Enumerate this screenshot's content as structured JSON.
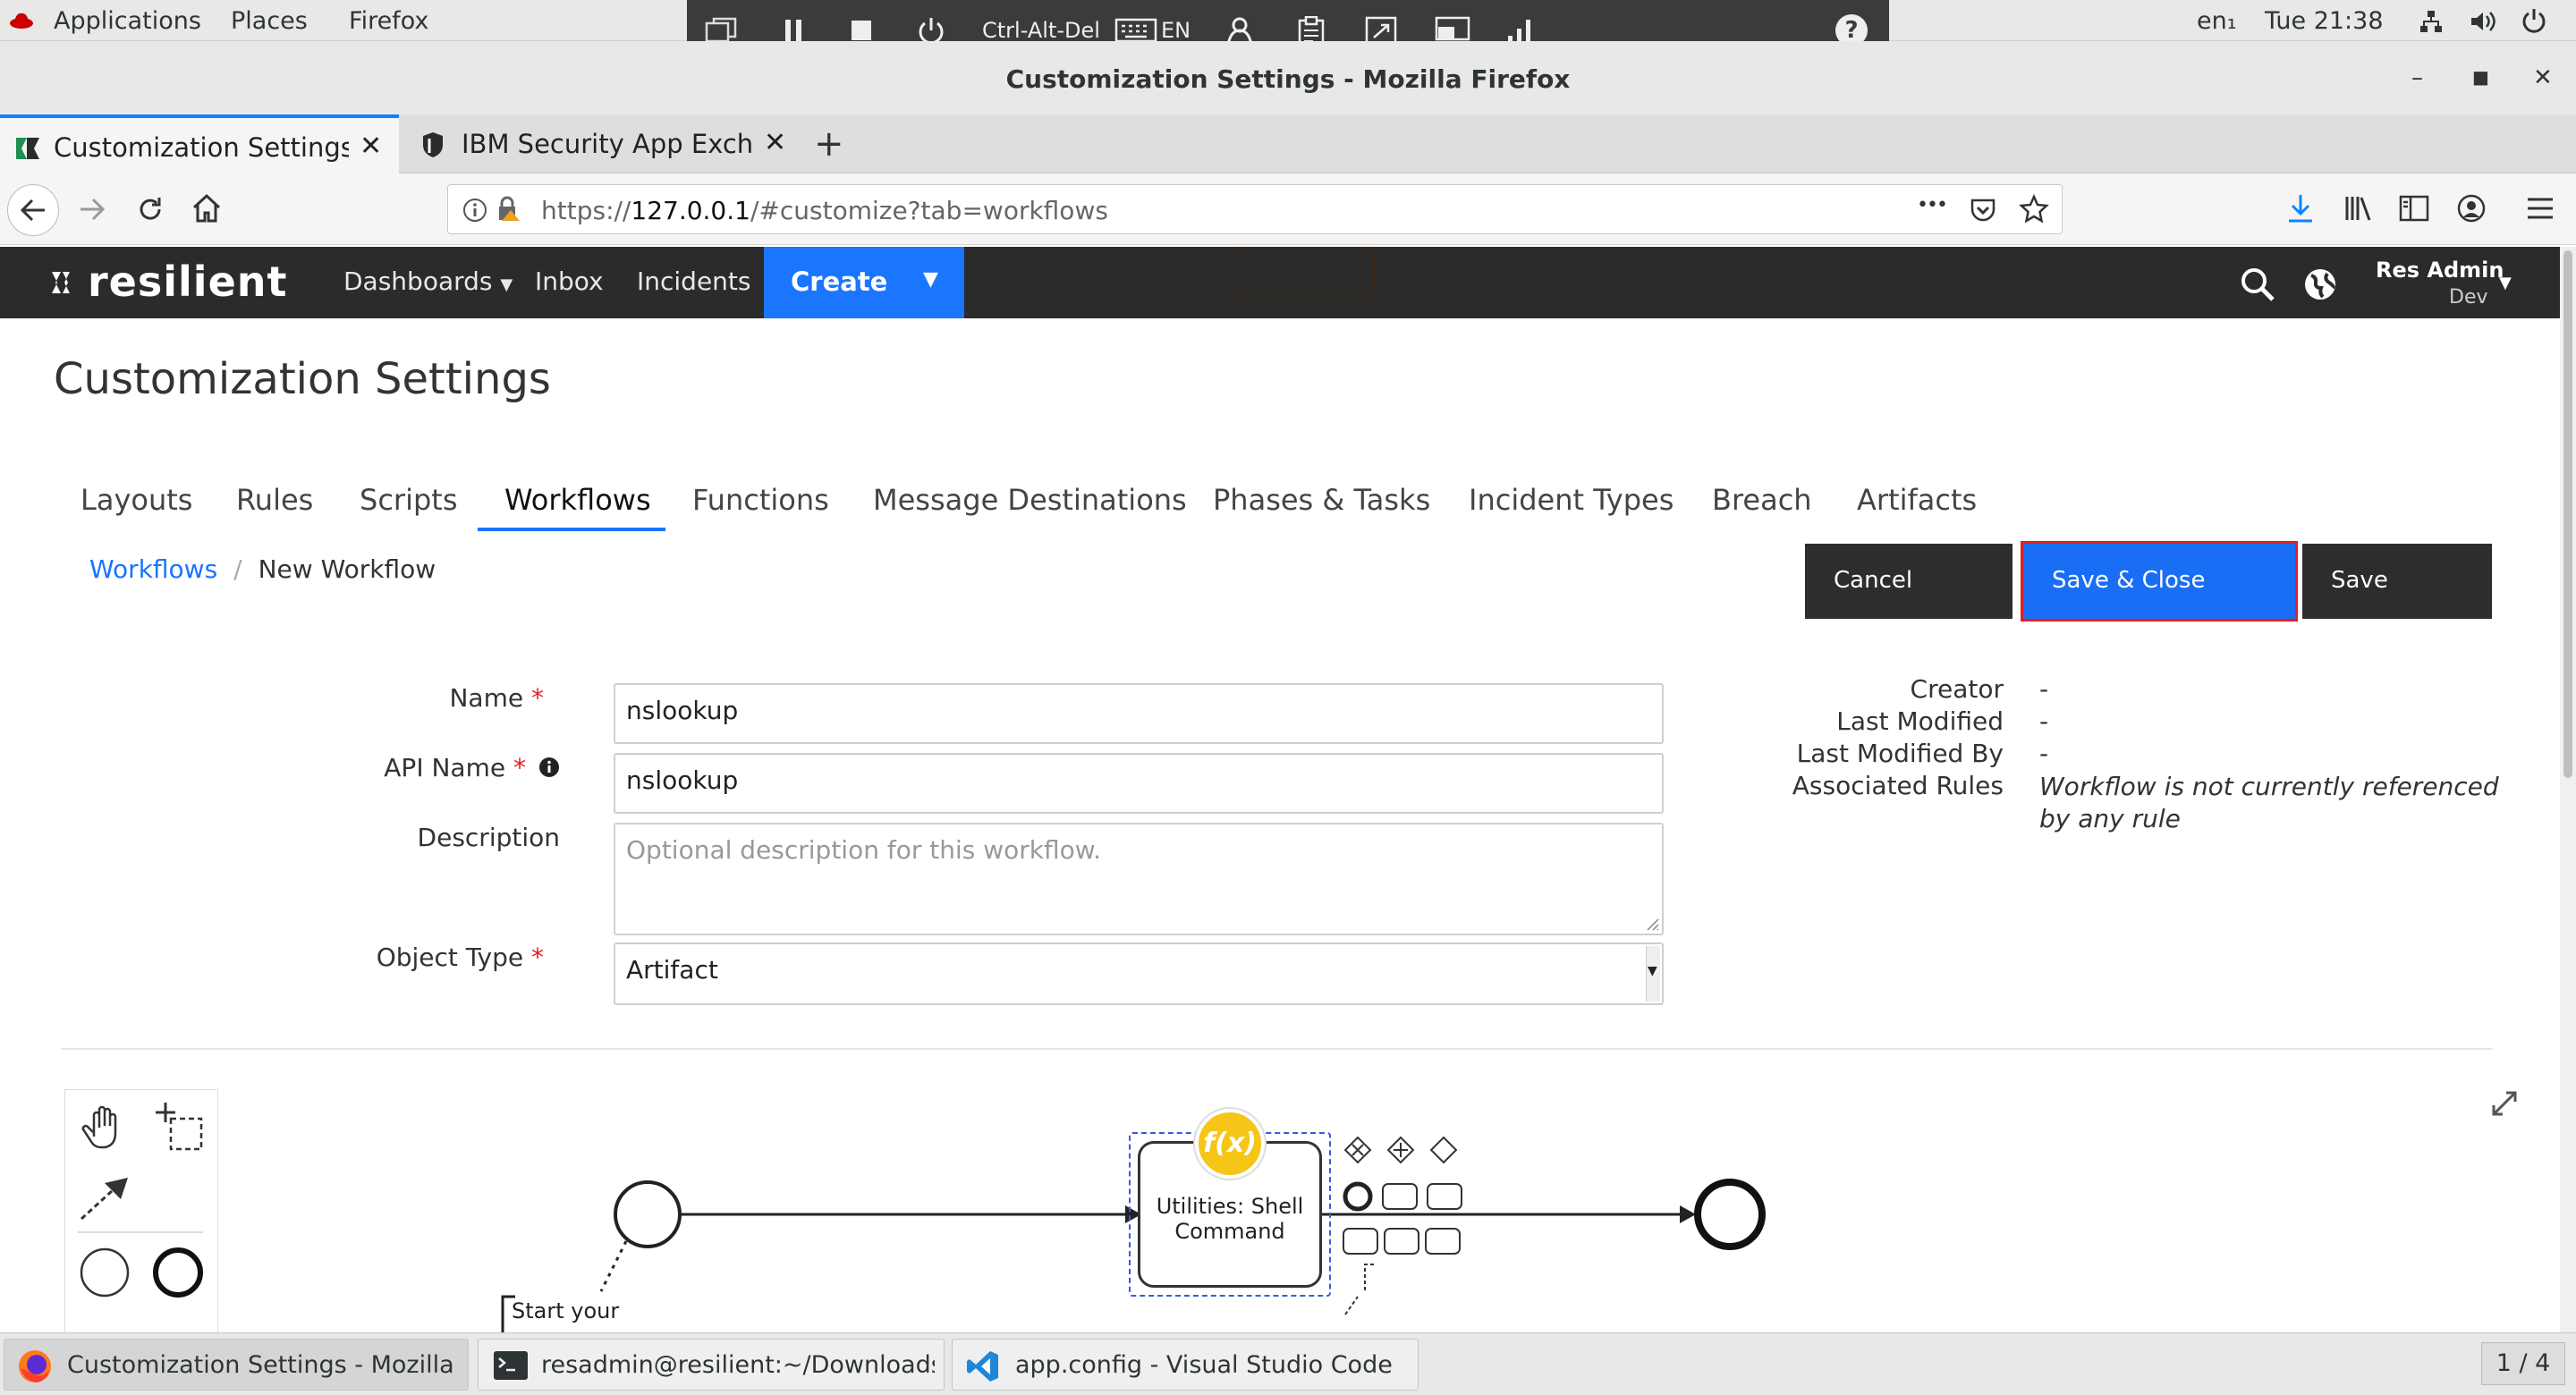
{
  "gnome_topbar": {
    "menus": [
      "Applications",
      "Places",
      "Firefox"
    ],
    "lang": "en₁",
    "clock": "Tue 21:38"
  },
  "vnc_toolbar": {
    "ctrl_alt_del": "Ctrl-Alt-Del",
    "keyboard_lang": "EN",
    "help": "?"
  },
  "window": {
    "title": "Customization Settings - Mozilla Firefox"
  },
  "browser": {
    "tabs": [
      {
        "label": "Customization Settings",
        "active": true
      },
      {
        "label": "IBM Security App Exchange",
        "active": false
      }
    ],
    "new_tab": "+",
    "url_prefix": "https://",
    "url_host": "127.0.0.1",
    "url_path": "/#customize?tab=workflows",
    "more_actions": "•••"
  },
  "resilient_header": {
    "logo": "resilient",
    "nav": [
      "Dashboards",
      "Inbox",
      "Incidents"
    ],
    "create_label": "Create",
    "user_name": "Res Admin",
    "user_org": "Dev"
  },
  "page": {
    "title": "Customization Settings",
    "tabs": [
      "Layouts",
      "Rules",
      "Scripts",
      "Workflows",
      "Functions",
      "Message Destinations",
      "Phases & Tasks",
      "Incident Types",
      "Breach",
      "Artifacts"
    ],
    "active_tab": "Workflows",
    "breadcrumb": {
      "parent": "Workflows",
      "separator": "/",
      "current": "New Workflow"
    },
    "buttons": {
      "cancel": "Cancel",
      "save_close": "Save & Close",
      "save": "Save"
    }
  },
  "form": {
    "name_label": "Name",
    "name_value": "nslookup",
    "api_name_label": "API Name",
    "api_name_value": "nslookup",
    "description_label": "Description",
    "description_placeholder": "Optional description for this workflow.",
    "object_type_label": "Object Type",
    "object_type_value": "Artifact",
    "required_mark": "*"
  },
  "meta": {
    "creator_label": "Creator",
    "creator_value": "-",
    "last_modified_label": "Last Modified",
    "last_modified_value": "-",
    "last_modified_by_label": "Last Modified By",
    "last_modified_by_value": "-",
    "associated_rules_label": "Associated Rules",
    "associated_rules_value": "Workflow is not currently referenced by any rule"
  },
  "designer": {
    "task_label": "Utilities: Shell Command",
    "fx_badge": "f(x)",
    "start_annotation": "Start your"
  },
  "taskbar": {
    "items": [
      {
        "label": "Customization Settings - Mozilla Fir...",
        "active": true
      },
      {
        "label": "resadmin@resilient:~/Downloads",
        "active": false
      },
      {
        "label": "app.config - Visual Studio Code",
        "active": false
      }
    ],
    "workspace": "1 / 4"
  }
}
